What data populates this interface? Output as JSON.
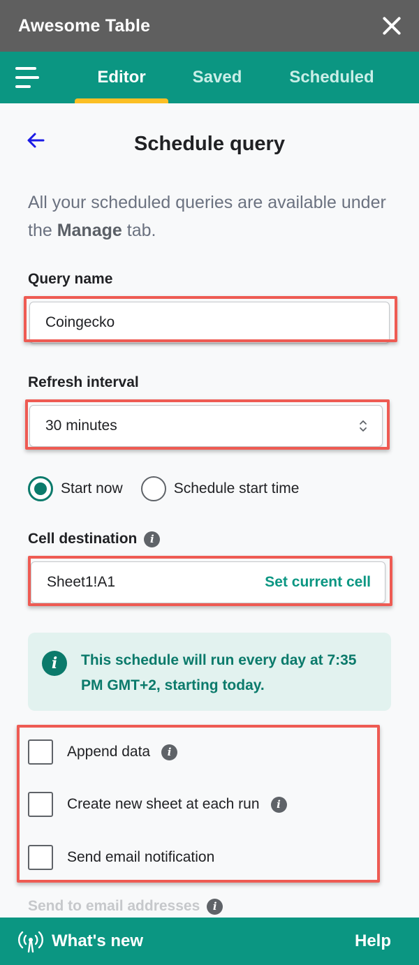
{
  "app": {
    "title": "Awesome Table"
  },
  "nav": {
    "tabs": [
      {
        "label": "Editor",
        "active": true
      },
      {
        "label": "Saved",
        "active": false
      },
      {
        "label": "Scheduled",
        "active": false
      }
    ]
  },
  "header": {
    "title": "Schedule query"
  },
  "intro": {
    "text_before": "All your scheduled queries are available under the ",
    "bold": "Manage",
    "text_after": " tab."
  },
  "query_name": {
    "label": "Query name",
    "value": "Coingecko"
  },
  "refresh_interval": {
    "label": "Refresh interval",
    "value": "30 minutes"
  },
  "start": {
    "options": [
      {
        "label": "Start now",
        "checked": true
      },
      {
        "label": "Schedule start time",
        "checked": false
      }
    ]
  },
  "cell_destination": {
    "label": "Cell destination",
    "value": "Sheet1!A1",
    "action": "Set current cell"
  },
  "notice": {
    "text": "This schedule will run every day at 7:35 PM GMT+2, starting today."
  },
  "options": [
    {
      "label": "Append data",
      "has_info": true,
      "checked": false
    },
    {
      "label": "Create new sheet at each run",
      "has_info": true,
      "checked": false
    },
    {
      "label": "Send email notification",
      "has_info": false,
      "checked": false
    }
  ],
  "email": {
    "label": "Send to email addresses"
  },
  "footer": {
    "whats_new": "What's new",
    "help": "Help"
  },
  "colors": {
    "brand_teal": "#0b9682",
    "title_bar": "#5f5f5f",
    "tab_indicator": "#fbbf24",
    "highlight": "#ee5b53",
    "notice_bg": "#e2f2ef"
  },
  "icons": {
    "info": "i"
  }
}
